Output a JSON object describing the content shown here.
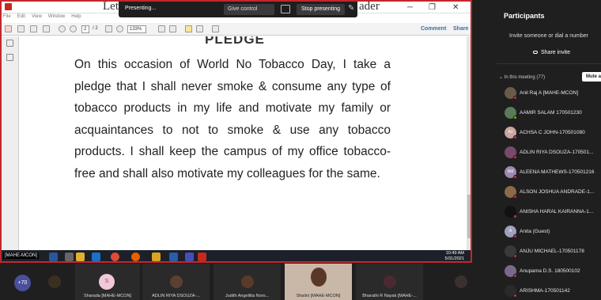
{
  "pdf_window": {
    "title_left": "Lett",
    "title_right": "ader",
    "menu": [
      "File",
      "Edit",
      "View",
      "Window",
      "Help"
    ],
    "page_current": "2",
    "page_total": "/ 2",
    "zoom": "133%",
    "comment_label": "Comment",
    "share_label": "Share"
  },
  "presenting_bar": {
    "status": "Presenting...",
    "give_control": "Give control",
    "stop_presenting": "Stop presenting"
  },
  "document": {
    "heading": "PLEDGE",
    "body": "On this occasion of World No Tobacco Day, I take a pledge that I shall never smoke & consume any type of tobacco products in my life and motivate my family or acquaintances to not to smoke & use any tobacco products. I shall keep the campus of my office tobacco-free and shall also motivate my colleagues for the same."
  },
  "taskbar": {
    "user_label": "[MAHE-MCON]",
    "time": "10:49 AM",
    "date": "5/31/2021"
  },
  "participants_panel": {
    "title": "Participants",
    "invite_placeholder": "Invite someone or dial a number",
    "share_invite": "Share invite",
    "section_label": "In this meeting (77)",
    "mute_all": "Mute a",
    "participants": [
      {
        "name": "Anil Raj A [MAHE-MCON]",
        "initials": "",
        "color": "#6a5a4a"
      },
      {
        "name": "AAMIR SALAM 170501230",
        "initials": "",
        "color": "#5b7a5a"
      },
      {
        "name": "ACHSA C JOHN-170501080",
        "initials": "AJ",
        "color": "#c9a6a0"
      },
      {
        "name": "ADLIN RIYA DSOUZA-170501...",
        "initials": "",
        "color": "#7a4a6a"
      },
      {
        "name": "ALEENA MATHEWS-170501216",
        "initials": "AM",
        "color": "#9c8ab0"
      },
      {
        "name": "ALSON JOSHUA ANDRADE-1...",
        "initials": "",
        "color": "#8a6a4a"
      },
      {
        "name": "ANISHA HARAL KAIRANNA-1...",
        "initials": "",
        "color": "#111111"
      },
      {
        "name": "Anita (Guest)",
        "initials": "A",
        "color": "#a0a0c0"
      },
      {
        "name": "ANJU MICHAEL-170501178",
        "initials": "",
        "color": "#3a3a3a"
      },
      {
        "name": "Anupama D.S. 180500102",
        "initials": "",
        "color": "#7a6a8a"
      },
      {
        "name": "ARISHMA-170501142",
        "initials": "",
        "color": "#2a2a2a"
      }
    ]
  },
  "gallery": {
    "overflow_count": "+70",
    "tiles": [
      {
        "name": "",
        "color": "#3a3020"
      },
      {
        "name": "Sharada [MAHE-MCON]",
        "initials": "S",
        "color": "#f0c8d8"
      },
      {
        "name": "ADLIN RIYA DSOUZA-...",
        "color": "#5a4030"
      },
      {
        "name": "Judith Angelitta Noro...",
        "color": "#5a3a2a"
      },
      {
        "name": "Shalini [MAHE-MCON]",
        "color": "#d8b8a0"
      },
      {
        "name": "Bharathi R Nayak [MAHE-...",
        "color": "#4a2a30"
      },
      {
        "name": "",
        "color": "#3a3030"
      }
    ]
  },
  "colors": {
    "share_border": "#c4262e",
    "teams_bg": "#1f1f1f",
    "overflow_badge": "#4a4f9c",
    "pdf_red": "#c8281d"
  }
}
